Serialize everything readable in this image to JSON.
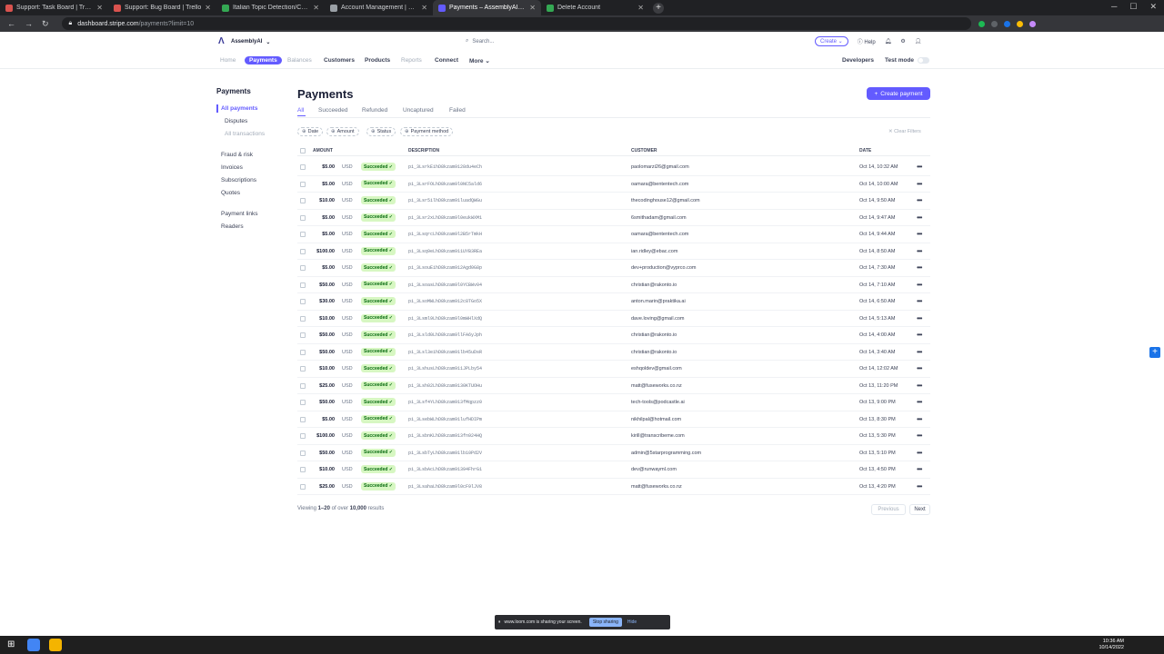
{
  "browser": {
    "tabs": [
      {
        "title": "Support: Task Board | Trello",
        "color": "#d9534f"
      },
      {
        "title": "Support: Bug Board | Trello",
        "color": "#d9534f"
      },
      {
        "title": "Italian Topic Detection/Content M",
        "color": "#34a853"
      },
      {
        "title": "Account Management | Retool",
        "color": "#9aa0a6"
      },
      {
        "title": "Payments – AssemblyAI – Stripe",
        "color": "#635bff"
      },
      {
        "title": "Delete Account",
        "color": "#34a853"
      }
    ],
    "url_host": "dashboard.stripe.com",
    "url_path": "/payments?limit=10"
  },
  "header": {
    "account": "AssemblyAI",
    "search_placeholder": "Search...",
    "create": "Create",
    "help": "Help"
  },
  "nav": {
    "home": "Home",
    "payments": "Payments",
    "balances": "Balances",
    "customers": "Customers",
    "products": "Products",
    "reports": "Reports",
    "connect": "Connect",
    "more": "More",
    "developers": "Developers",
    "test_mode": "Test mode"
  },
  "sidebar": {
    "title": "Payments",
    "items": [
      "All payments",
      "Disputes",
      "All transactions",
      "Fraud & risk",
      "Invoices",
      "Subscriptions",
      "Quotes",
      "Payment links",
      "Readers"
    ]
  },
  "main": {
    "title": "Payments",
    "create_payment": "Create payment",
    "tabs": [
      "All",
      "Succeeded",
      "Refunded",
      "Uncaptured",
      "Failed"
    ],
    "filters": [
      "Date",
      "Amount",
      "Status",
      "Payment method"
    ],
    "clear_filters": "Clear Filters",
    "columns": [
      "AMOUNT",
      "DESCRIPTION",
      "CUSTOMER",
      "DATE"
    ],
    "rows": [
      {
        "amount": "$5.00",
        "currency": "USD",
        "status": "Succeeded",
        "desc": "pi_3LsrkEihD8kzam9128du4eCh",
        "customer": "paolomarzi26@gmail.com",
        "date": "Oct 14, 10:32 AM"
      },
      {
        "amount": "$5.00",
        "currency": "USD",
        "status": "Succeeded",
        "desc": "pi_3LsrFOLhD8kzam9l0NC5ald6",
        "customer": "oamara@bententech.com",
        "date": "Oct 14, 10:00 AM"
      },
      {
        "amount": "$10.00",
        "currency": "USD",
        "status": "Succeeded",
        "desc": "pi_3Lsr5ilhD8kzam91luadQWGu",
        "customer": "thecodinghouse12@gmail.com",
        "date": "Oct 14, 9:50 AM"
      },
      {
        "amount": "$5.00",
        "currency": "USD",
        "status": "Succeeded",
        "desc": "pi_3Lsr2xLhD8kzam9l0eukWXM1",
        "customer": "6smithadam@gmail.com",
        "date": "Oct 14, 9:47 AM"
      },
      {
        "amount": "$5.00",
        "currency": "USD",
        "status": "Succeeded",
        "desc": "pi_3LsqrcLhD8kzam9l2B5rTmkH",
        "customer": "oamara@bententech.com",
        "date": "Oct 14, 9:44 AM"
      },
      {
        "amount": "$100.00",
        "currency": "USD",
        "status": "Succeeded",
        "desc": "pi_3Lsq9eLhD8kzam911UYB3REa",
        "customer": "ian.ridley@ebac.com",
        "date": "Oct 14, 8:50 AM"
      },
      {
        "amount": "$5.00",
        "currency": "USD",
        "status": "Succeeded",
        "desc": "pi_3LsouEihD8kzam912Agd0G8p",
        "customer": "dev+production@vyprco.com",
        "date": "Oct 14, 7:30 AM"
      },
      {
        "amount": "$50.00",
        "currency": "USD",
        "status": "Succeeded",
        "desc": "pi_3LsoasLhD8kzam9l0YCBWv04",
        "customer": "christian@rakonto.io",
        "date": "Oct 14, 7:10 AM"
      },
      {
        "amount": "$30.00",
        "currency": "USD",
        "status": "Succeeded",
        "desc": "pi_3LsoMWLhD8kzam912c8TGo5X",
        "customer": "anton.marin@praktika.ai",
        "date": "Oct 14, 6:50 AM"
      },
      {
        "amount": "$10.00",
        "currency": "USD",
        "status": "Succeeded",
        "desc": "pi_3Lsml9LhD8kzam9l0mWHlXdQ",
        "customer": "dave.loving@gmail.com",
        "date": "Oct 14, 5:13 AM"
      },
      {
        "amount": "$50.00",
        "currency": "USD",
        "status": "Succeeded",
        "desc": "pi_3Lsld0LhD8kzam9llFA6yJph",
        "customer": "christian@rakonto.io",
        "date": "Oct 14, 4:00 AM"
      },
      {
        "amount": "$50.00",
        "currency": "USD",
        "status": "Succeeded",
        "desc": "pi_3Lsl3eihD8kzam91lb45uDsR",
        "customer": "christian@rakonto.io",
        "date": "Oct 14, 3:40 AM"
      },
      {
        "amount": "$10.00",
        "currency": "USD",
        "status": "Succeeded",
        "desc": "pi_3LshusLhD8kzam911JPLby54",
        "customer": "eshqoldev@gmail.com",
        "date": "Oct 14, 12:02 AM"
      },
      {
        "amount": "$25.00",
        "currency": "USD",
        "status": "Succeeded",
        "desc": "pi_3Lsh02LhD8kzam9130KTUOHu",
        "customer": "matt@fuseworks.co.nz",
        "date": "Oct 13, 11:20 PM"
      },
      {
        "amount": "$50.00",
        "currency": "USD",
        "status": "Succeeded",
        "desc": "pi_3Lsf4YLhD8kzam913fMqpzz0",
        "customer": "tech-tools@podcastle.ai",
        "date": "Oct 13, 9:00 PM"
      },
      {
        "amount": "$5.00",
        "currency": "USD",
        "status": "Succeeded",
        "desc": "pi_3LsebWLhD8kzam91lufHDIPm",
        "customer": "nikhilpal@hotmail.com",
        "date": "Oct 13, 8:30 PM"
      },
      {
        "amount": "$100.00",
        "currency": "USD",
        "status": "Succeeded",
        "desc": "pi_3LsbnKLhD8kzam913fn924HQ",
        "customer": "kirill@transcribeme.com",
        "date": "Oct 13, 5:30 PM"
      },
      {
        "amount": "$50.00",
        "currency": "USD",
        "status": "Succeeded",
        "desc": "pi_3LsbTyLhD8kzam91lb10Pd2V",
        "customer": "admin@5starprogramming.com",
        "date": "Oct 13, 5:10 PM"
      },
      {
        "amount": "$10.00",
        "currency": "USD",
        "status": "Succeeded",
        "desc": "pi_3LsbAcLhD8kzam91394FhrG1",
        "customer": "dev@runwayml.com",
        "date": "Oct 13, 4:50 PM"
      },
      {
        "amount": "$25.00",
        "currency": "USD",
        "status": "Succeeded",
        "desc": "pi_3LsahaLhD8kzam9l0cF9lJV8",
        "customer": "matt@fuseworks.co.nz",
        "date": "Oct 13, 4:20 PM"
      }
    ],
    "pager_prefix": "Viewing ",
    "pager_range": "1–20",
    "pager_mid": " of over ",
    "pager_total": "10,000",
    "pager_suffix": " results",
    "previous": "Previous",
    "next": "Next"
  },
  "share_bar": {
    "text": "www.loom.com is sharing your screen.",
    "stop": "Stop sharing",
    "hide": "Hide"
  },
  "taskbar": {
    "time": "10:36 AM",
    "date": "10/14/2022"
  },
  "colors": {
    "accent": "#635bff",
    "success_bg": "#d7f7c2",
    "success_text": "#05690d"
  }
}
